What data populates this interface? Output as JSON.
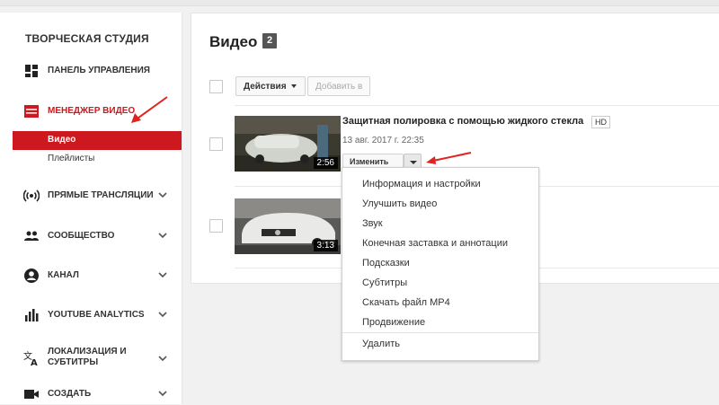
{
  "sidebar": {
    "studio_title": "ТВОРЧЕСКАЯ СТУДИЯ",
    "items": [
      {
        "label": "ПАНЕЛЬ УПРАВЛЕНИЯ",
        "icon": "dashboard-icon"
      },
      {
        "label": "МЕНЕДЖЕР ВИДЕО",
        "icon": "video-manager-icon",
        "active": true
      },
      {
        "label": "ПРЯМЫЕ ТРАНСЛЯЦИИ",
        "icon": "live-broadcast-icon"
      },
      {
        "label": "СООБЩЕСТВО",
        "icon": "community-icon"
      },
      {
        "label": "КАНАЛ",
        "icon": "channel-icon"
      },
      {
        "label": "YOUTUBE ANALYTICS",
        "icon": "analytics-icon"
      },
      {
        "label_line1": "ЛОКАЛИЗАЦИЯ И",
        "label_line2": "СУБТИТРЫ",
        "icon": "translate-icon"
      },
      {
        "label": "СОЗДАТЬ",
        "icon": "create-video-icon"
      }
    ],
    "subitems": [
      {
        "label": "Видео",
        "active": true
      },
      {
        "label": "Плейлисты"
      }
    ]
  },
  "main": {
    "title": "Видео",
    "count": "2",
    "toolbar": {
      "actions_label": "Действия",
      "add_label": "Добавить в"
    },
    "videos": [
      {
        "title": "Защитная полировка с помощью жидкого стекла",
        "badge": "HD",
        "date": "13 авг. 2017 г. 22:35",
        "duration": "2:56",
        "edit_label": "Изменить"
      },
      {
        "duration": "3:13"
      }
    ]
  },
  "dropdown": {
    "items": [
      "Информация и настройки",
      "Улучшить видео",
      "Звук",
      "Конечная заставка и аннотации",
      "Подсказки",
      "Субтитры",
      "Скачать файл MP4",
      "Продвижение"
    ],
    "delete_label": "Удалить"
  },
  "colors": {
    "accent": "#cc181e",
    "annotation_arrow": "#e0231c"
  }
}
